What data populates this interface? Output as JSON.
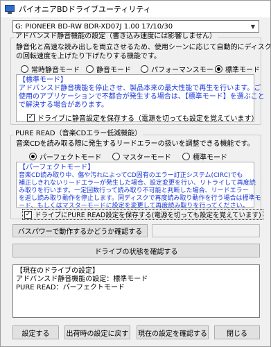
{
  "window": {
    "title": "パイオニアBDドライブユーティリティ",
    "app_icon": "monitor-icon"
  },
  "drive_select": {
    "value": "G: PIONEER BD-RW   BDR-XD07J 1.00 17/10/30",
    "arrow_icon": "chevron-down-icon"
  },
  "silent": {
    "group_title": "アドバンスド静音機能の設定（書き込み速度には影響しません）",
    "description_line1": "静音化と高速な読み出しを両立させるため、使用シーンに応じて自動的にディスク",
    "description_line2": "の回転速度を上げたり下げたりする機能です。",
    "options": [
      {
        "label": "常時静音モード",
        "selected": false
      },
      {
        "label": "静音モード",
        "selected": false
      },
      {
        "label": "パフォーマンスモード",
        "selected": false
      },
      {
        "label": "標準モード",
        "selected": true
      }
    ],
    "info_title": "【標準モード】",
    "info_line1": "アドバンスド静音機能を停止させ、製品本来の最大性能で再生を行います。ご",
    "info_line2": "使用のアプリケーションで不都合が発生する場合は、【標準モード】を選ぶこと",
    "info_line3": "で解決する場合があります。",
    "save_checkbox_label": "ドライブに静音設定を保存する（電源を切っても設定を覚えています）",
    "save_checked": true
  },
  "pureread": {
    "group_title": "PURE READ（音楽CDエラー低減機能）",
    "description": "音楽CDを読み取る際に発生するリードエラーの扱いを調整できる機能です。",
    "options": [
      {
        "label": "パーフェクトモード",
        "selected": true
      },
      {
        "label": "マスターモード",
        "selected": false
      },
      {
        "label": "標準モード",
        "selected": false
      }
    ],
    "info_title": "【パーフェクトモード】",
    "info_line1": "音楽CD読み取り中、傷や汚れによってCD固有のエラー訂正システム(CIRC)でも",
    "info_line2": "補正しきれないリードエラーが発生した場合、設定変更を行い、リトライして再度読",
    "info_line3": "み取りを行います。一定回数行って読み取り不可能と判断した場合、リードエラー",
    "info_line4": "を返し読み取り動作を停止します。同ディスクで再度読み取り動作を行う場合は標準モ",
    "info_line5": "ード、もしくはマスターモードに設定を変更して再度読み取りを行ってください。",
    "save_checkbox_label": "ドライブにPURE READ設定を保存する(電源を切っても設定を覚えています)",
    "save_checked": true
  },
  "bus_power_button": "バスパワーで動作するかどうか確認する",
  "bus_power_result": "",
  "check_drive_button": "ドライブの状態を確認する",
  "status": {
    "heading": "【現在のドライブの設定】",
    "line1": "アドバンスド静音機能の設定：標準モード",
    "line2": "PURE READ：パーフェクトモード"
  },
  "buttons": {
    "apply": "設定する",
    "factory_reset": "出荷時の設定に戻す",
    "check_current": "現在の設定を確認する",
    "close": "閉じる"
  }
}
